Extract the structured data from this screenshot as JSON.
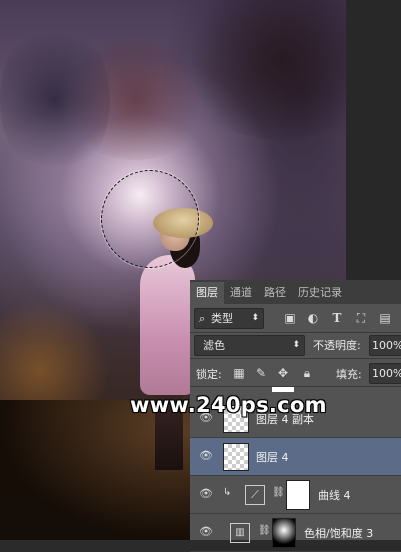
{
  "watermark": "www.240ps.com",
  "panel": {
    "tabs": [
      "图层",
      "通道",
      "路径",
      "历史记录"
    ],
    "filter_kind": "类型",
    "blend_mode": "滤色",
    "opacity_label": "不透明度:",
    "opacity_value": "100%",
    "lock_label": "锁定:",
    "fill_label": "填充:",
    "fill_value": "100%",
    "layers": [
      {
        "name": "图层 4 副本"
      },
      {
        "name": "图层 4"
      },
      {
        "name": "曲线 4"
      },
      {
        "name": "色相/饱和度 3"
      }
    ]
  },
  "colors": {
    "panel_bg": "#535353",
    "tab_bar_bg": "#3d3d3d",
    "selected_layer": "#5c6c88",
    "field_bg": "#383838"
  }
}
